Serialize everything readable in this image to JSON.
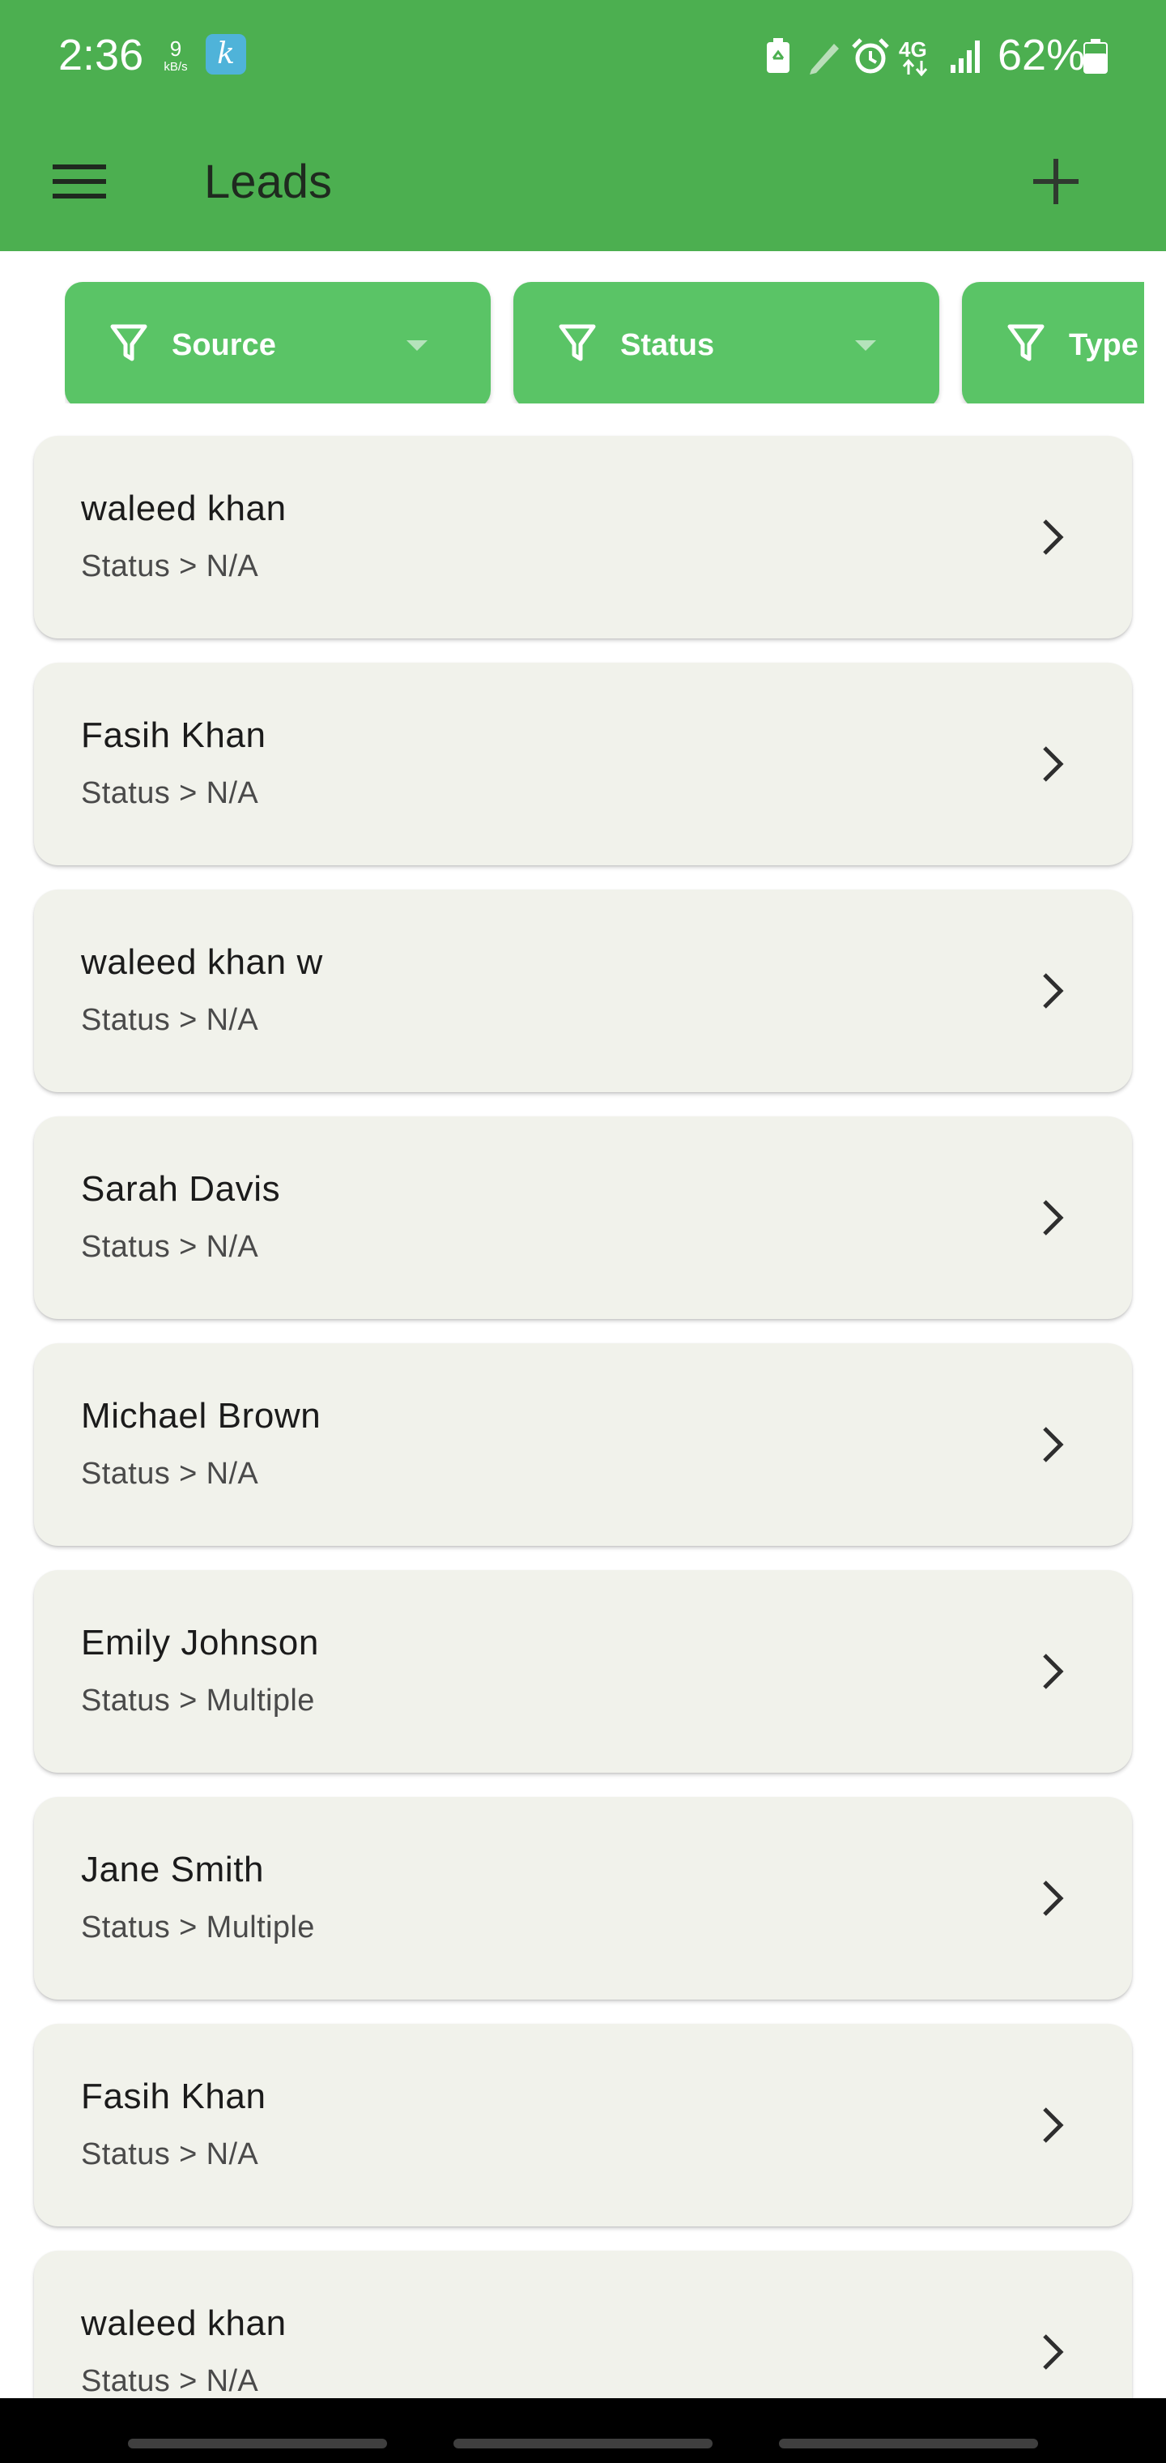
{
  "status_bar": {
    "time": "2:36",
    "net_speed_value": "9",
    "net_speed_unit": "kB/s",
    "app_badge_letter": "k",
    "icons": [
      "battery-saver-icon",
      "pencil-icon",
      "alarm-icon",
      "4g-data-icon",
      "signal-icon",
      "battery-icon"
    ],
    "network_label": "4G",
    "battery_percent": "62%"
  },
  "app_bar": {
    "title": "Leads",
    "menu_icon": "menu-icon",
    "add_icon": "plus-icon",
    "color": "#4caf50"
  },
  "filters": [
    {
      "label": "Source",
      "icon": "filter-icon"
    },
    {
      "label": "Status",
      "icon": "filter-icon"
    },
    {
      "label": "Type",
      "icon": "filter-icon"
    }
  ],
  "leads": [
    {
      "name": "waleed khan",
      "status": "Status > N/A"
    },
    {
      "name": "Fasih Khan",
      "status": "Status > N/A"
    },
    {
      "name": "waleed khan w",
      "status": "Status > N/A"
    },
    {
      "name": "Sarah Davis",
      "status": "Status > N/A"
    },
    {
      "name": "Michael Brown",
      "status": "Status > N/A"
    },
    {
      "name": "Emily Johnson",
      "status": "Status > Multiple"
    },
    {
      "name": "Jane Smith",
      "status": "Status > Multiple"
    },
    {
      "name": "Fasih Khan",
      "status": "Status > N/A"
    },
    {
      "name": "waleed khan",
      "status": "Status > N/A"
    }
  ],
  "colors": {
    "primary": "#4caf50",
    "chip": "#5ac466",
    "card_background": "#f1f2eb"
  }
}
